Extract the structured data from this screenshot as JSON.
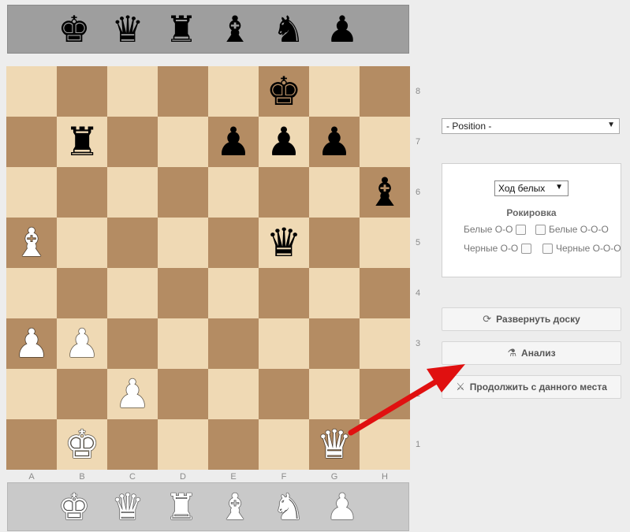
{
  "spare_pieces": {
    "black": [
      {
        "icon": "black-king-icon",
        "glyph": "♚"
      },
      {
        "icon": "black-queen-icon",
        "glyph": "♛"
      },
      {
        "icon": "black-rook-icon",
        "glyph": "♜"
      },
      {
        "icon": "black-bishop-icon",
        "glyph": "♝"
      },
      {
        "icon": "black-knight-icon",
        "glyph": "♞"
      },
      {
        "icon": "black-pawn-icon",
        "glyph": "♟"
      }
    ],
    "white": [
      {
        "icon": "white-king-icon",
        "glyph": "♚"
      },
      {
        "icon": "white-queen-icon",
        "glyph": "♛"
      },
      {
        "icon": "white-rook-icon",
        "glyph": "♜"
      },
      {
        "icon": "white-bishop-icon",
        "glyph": "♝"
      },
      {
        "icon": "white-knight-icon",
        "glyph": "♞"
      },
      {
        "icon": "white-pawn-icon",
        "glyph": "♟"
      }
    ]
  },
  "board": {
    "ranks": [
      "8",
      "7",
      "6",
      "5",
      "4",
      "3",
      "2",
      "1"
    ],
    "files": [
      "A",
      "B",
      "C",
      "D",
      "E",
      "F",
      "G",
      "H"
    ],
    "pieces": [
      {
        "square": "f8",
        "color": "b",
        "type": "king"
      },
      {
        "square": "b7",
        "color": "b",
        "type": "rook"
      },
      {
        "square": "e7",
        "color": "b",
        "type": "pawn"
      },
      {
        "square": "f7",
        "color": "b",
        "type": "pawn"
      },
      {
        "square": "g7",
        "color": "b",
        "type": "pawn"
      },
      {
        "square": "h6",
        "color": "b",
        "type": "bishop"
      },
      {
        "square": "a5",
        "color": "w",
        "type": "bishop"
      },
      {
        "square": "f5",
        "color": "b",
        "type": "queen"
      },
      {
        "square": "a3",
        "color": "w",
        "type": "pawn"
      },
      {
        "square": "b3",
        "color": "w",
        "type": "pawn"
      },
      {
        "square": "c2",
        "color": "w",
        "type": "pawn"
      },
      {
        "square": "b1",
        "color": "w",
        "type": "king"
      },
      {
        "square": "g1",
        "color": "w",
        "type": "queen"
      }
    ],
    "colors": {
      "light": "#efd9b4",
      "dark": "#b48c63"
    }
  },
  "position_select": {
    "value": "- Position -"
  },
  "setup_panel": {
    "turn_value": "Ход белых",
    "castling_title": "Рокировка",
    "white_oo": "Белые О-О",
    "white_ooo": "Белые О-О-О",
    "black_oo": "Черные О-О",
    "black_ooo": "Черные О-О-О"
  },
  "buttons": {
    "flip": "Развернуть доску",
    "analysis": "Анализ",
    "continue": "Продолжить с данного места"
  },
  "annotation": {
    "arrow_color": "#e01010"
  }
}
